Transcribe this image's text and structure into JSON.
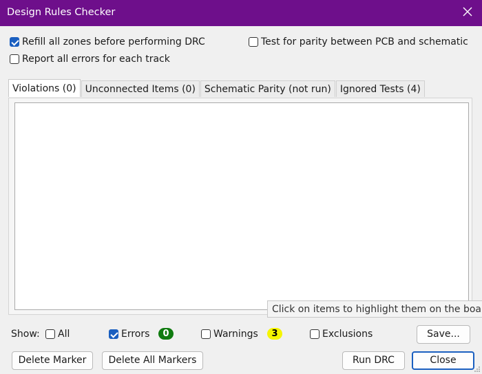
{
  "window": {
    "title": "Design Rules Checker"
  },
  "options": {
    "refill_zones": {
      "label": "Refill all zones before performing DRC",
      "checked": true
    },
    "test_parity": {
      "label": "Test for parity between PCB and schematic",
      "checked": false
    },
    "report_all_errors": {
      "label": "Report all errors for each track",
      "checked": false
    }
  },
  "tabs": [
    {
      "label": "Violations (0)",
      "active": true
    },
    {
      "label": "Unconnected Items (0)",
      "active": false
    },
    {
      "label": "Schematic Parity (not run)",
      "active": false
    },
    {
      "label": "Ignored Tests (4)",
      "active": false
    }
  ],
  "tooltip": "Click on items to highlight them on the board.",
  "filters": {
    "show_label": "Show:",
    "all": {
      "label": "All",
      "checked": false
    },
    "errors": {
      "label": "Errors",
      "checked": true,
      "count": "0"
    },
    "warnings": {
      "label": "Warnings",
      "checked": false,
      "count": "3"
    },
    "exclusions": {
      "label": "Exclusions",
      "checked": false
    }
  },
  "buttons": {
    "save": "Save...",
    "delete_marker": "Delete Marker",
    "delete_all_markers": "Delete All Markers",
    "run_drc": "Run DRC",
    "close": "Close"
  },
  "colors": {
    "titlebar": "#6e0f8b",
    "accent": "#1a5fc0",
    "errors_badge": "#0f7b0f",
    "warnings_badge": "#f5f500"
  }
}
